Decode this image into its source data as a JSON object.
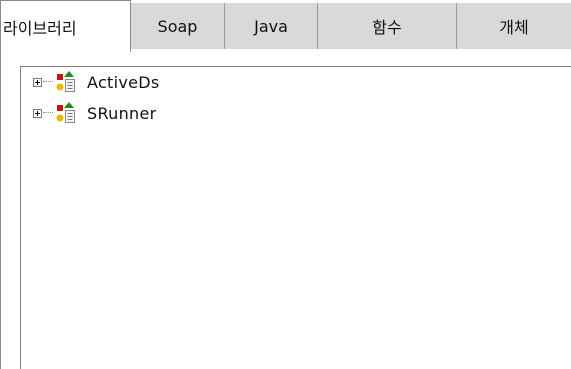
{
  "tabs": [
    {
      "label": "라이브러리",
      "active": true
    },
    {
      "label": "Soap",
      "active": false
    },
    {
      "label": "Java",
      "active": false
    },
    {
      "label": "함수",
      "active": false
    },
    {
      "label": "개체",
      "active": false
    }
  ],
  "tree": {
    "nodes": [
      {
        "label": "ActiveDs",
        "icon": "library-icon",
        "expander": "plus-icon"
      },
      {
        "label": "SRunner",
        "icon": "library-icon",
        "expander": "plus-icon"
      }
    ]
  },
  "colors": {
    "tab_inactive": "#d9d9d9",
    "border": "#8a8a8a",
    "icon_red": "#cc1111",
    "icon_green": "#1c8c1c",
    "icon_yellow": "#f2b500"
  }
}
